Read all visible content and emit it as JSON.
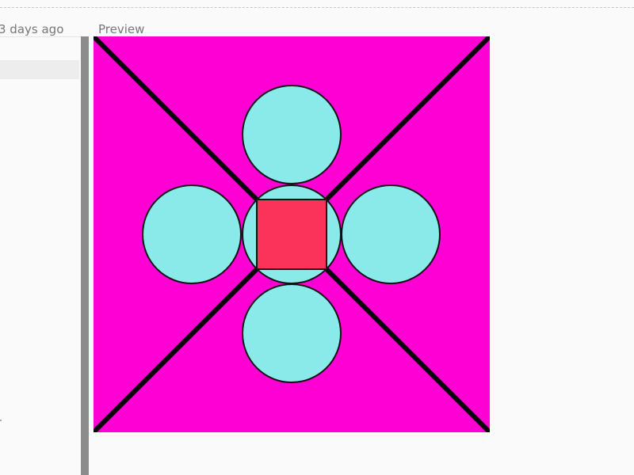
{
  "header": {
    "timestamp_label": "3 days ago",
    "preview_label": "Preview"
  },
  "preview": {
    "background_color": "#ff00d4",
    "diagonal_color": "#000000",
    "circle_color": "#8aeaea",
    "center_square_color": "#fb335b",
    "outline_color": "#111111"
  }
}
